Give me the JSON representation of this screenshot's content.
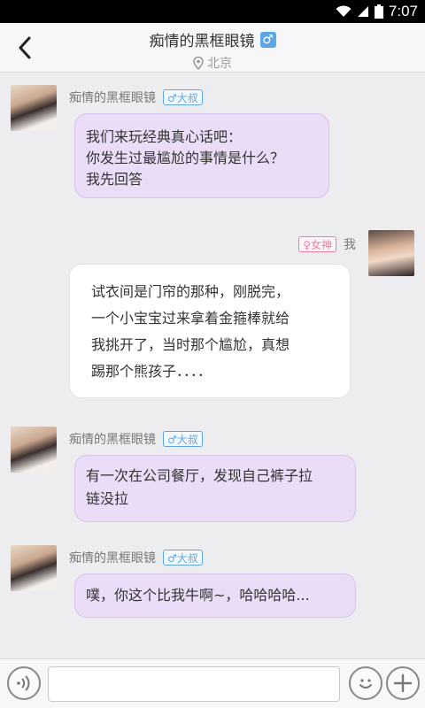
{
  "status_bar": {
    "time": "7:07"
  },
  "header": {
    "title": "痴情的黑框眼镜",
    "gender_symbol": "♂",
    "location": "北京"
  },
  "messages": [
    {
      "side": "left",
      "sender": "痴情的黑框眼镜",
      "tag": "♂大叔",
      "text": "我们来玩经典真心话吧：\n你发生过最尴尬的事情是什么？\n我先回答"
    },
    {
      "side": "right",
      "sender": "我",
      "tag": "♀女神",
      "text": "试衣间是门帘的那种，刚脱完，\n一个小宝宝过来拿着金箍棒就给\n我挑开了，当时那个尴尬，真想\n踢那个熊孩子．．．．"
    },
    {
      "side": "left",
      "sender": "痴情的黑框眼镜",
      "tag": "♂大叔",
      "text": "有一次在公司餐厅，发现自己裤子拉\n链没拉"
    },
    {
      "side": "left",
      "sender": "痴情的黑框眼镜",
      "tag": "♂大叔",
      "text": "噗，你这个比我牛啊~，哈哈哈哈..."
    }
  ],
  "input": {
    "value": "",
    "placeholder": ""
  },
  "icons": {
    "back": "back-arrow-icon",
    "location": "location-pin-icon",
    "voice": "voice-icon",
    "emoji": "smiley-icon",
    "add": "plus-icon"
  },
  "colors": {
    "male_tag": "#5aa6e6",
    "female_tag": "#ef7fa0",
    "bubble_purple": "#ebdcf7",
    "bubble_white": "#ffffff"
  }
}
